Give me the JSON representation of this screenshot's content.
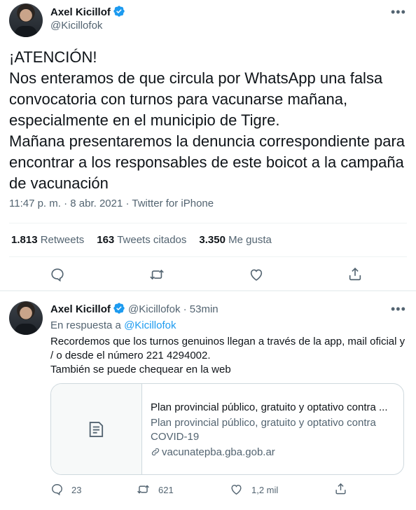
{
  "main_tweet": {
    "author_name": "Axel Kicillof",
    "author_handle": "@Kicillofok",
    "body": "¡ATENCIÓN!\nNos enteramos de que circula por WhatsApp una falsa convocatoria con turnos para vacunarse mañana, especialmente en el municipio de Tigre.\nMañana presentaremos la denuncia correspondiente para encontrar a los responsables de este boicot a la campaña de vacunación",
    "timestamp": "11:47 p. m. · 8 abr. 2021 · Twitter for iPhone",
    "stats": {
      "retweets_count": "1.813",
      "retweets_label": "Retweets",
      "quotes_count": "163",
      "quotes_label": "Tweets citados",
      "likes_count": "3.350",
      "likes_label": "Me gusta"
    },
    "actions": [
      "reply-icon",
      "retweet-icon",
      "like-icon",
      "share-icon"
    ]
  },
  "reply_tweet": {
    "author_name": "Axel Kicillof",
    "author_handle": "@Kicillofok",
    "time_ago": "· 53min",
    "in_reply_prefix": "En respuesta a",
    "in_reply_handle": "@Kicillofok",
    "body": "Recordemos que los turnos genuinos llegan a través de la app, mail oficial y / o desde el número 221 4294002.\nTambién se puede chequear en la web",
    "card": {
      "title": "Plan provincial público, gratuito y optativo contra ...",
      "description": "Plan provincial público, gratuito y optativo contra COVID-19",
      "domain": "vacunatepba.gba.gob.ar"
    },
    "counts": {
      "replies": "23",
      "retweets": "621",
      "likes": "1,2 mil"
    }
  },
  "colors": {
    "text": "#0f1419",
    "secondary": "#536471",
    "link": "#1d9bf0",
    "verified": "#1d9bf0",
    "border": "#cfd9de"
  }
}
